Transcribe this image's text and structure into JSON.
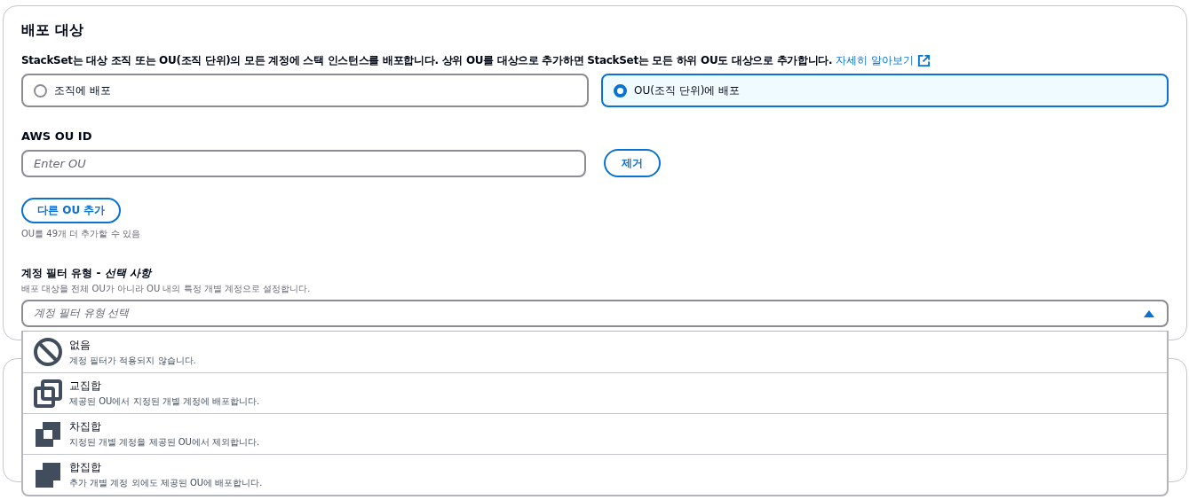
{
  "section": {
    "title": "배포 대상",
    "description": "StackSet는 대상 조직 또는 OU(조직 단위)의 모든 계정에 스택 인스턴스를 배포합니다. 상위 OU를 대상으로 추가하면 StackSet는 모든 하위 OU도 대상으로 추가합니다.",
    "learn_more_link": "자세히 알아보기",
    "deploy_options": [
      {
        "label": "조직에 배포",
        "selected": false
      },
      {
        "label": "OU(조직 단위)에 배포",
        "selected": true
      }
    ],
    "ou_field": {
      "label": "AWS OU ID",
      "placeholder": "Enter OU",
      "remove_button": "제거"
    },
    "add_ou_button": "다른 OU 추가",
    "add_ou_hint": "OU를 49개 더 추가할 수 있음",
    "filter": {
      "label": "계정 필터 유형 - *선택 사항*",
      "description": "배포 대상을 전체 OU가 아니라 OU 내의 특정 개별 계정으로 설정합니다.",
      "placeholder": "계정 필터 유형 선택",
      "expanded": true,
      "options": [
        {
          "kind": "none",
          "label": "없음",
          "description": "계정 필터가 적용되지 않습니다."
        },
        {
          "kind": "intersection",
          "label": "교집합",
          "description": "제공된 OU에서 지정된 개별 계정에 배포합니다."
        },
        {
          "kind": "difference",
          "label": "차집합",
          "description": "지정된 개별 계정을 제공된 OU에서 제외합니다."
        },
        {
          "kind": "union",
          "label": "합집합",
          "description": "추가 개별 계정 외에도 제공된 OU에 배포합니다."
        }
      ]
    }
  }
}
